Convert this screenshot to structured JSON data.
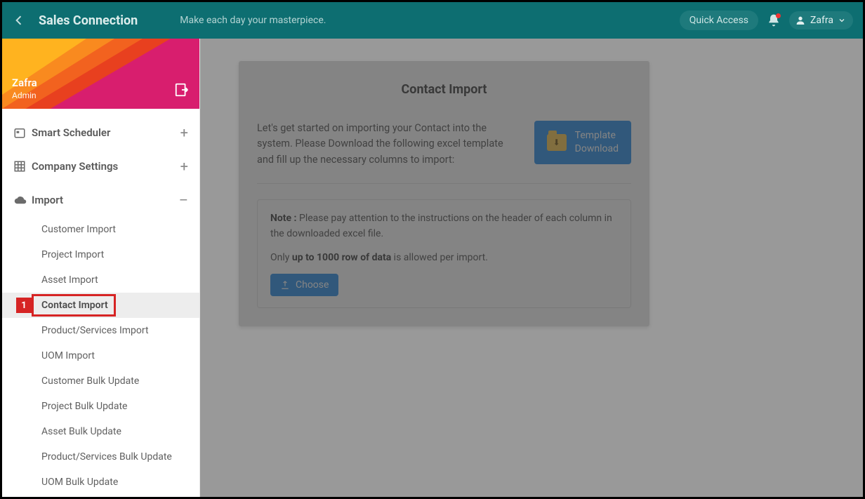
{
  "header": {
    "brand": "Sales Connection",
    "tagline": "Make each day your masterpiece.",
    "quick_access": "Quick Access",
    "user_name": "Zafra"
  },
  "profile": {
    "name": "Zafra",
    "role": "Admin"
  },
  "menu": {
    "smart_scheduler": "Smart Scheduler",
    "company_settings": "Company Settings",
    "import": "Import",
    "import_items": [
      "Customer Import",
      "Project Import",
      "Asset Import",
      "Contact Import",
      "Product/Services Import",
      "UOM Import",
      "Customer Bulk Update",
      "Project Bulk Update",
      "Asset Bulk Update",
      "Product/Services Bulk Update",
      "UOM Bulk Update"
    ],
    "active_index": 3
  },
  "callout": {
    "number": "1"
  },
  "main": {
    "title": "Contact Import",
    "intro": "Let's get started on importing your Contact into the system. Please Download the following excel template and fill up the necessary columns to import:",
    "template_btn_line1": "Template",
    "template_btn_line2": "Download",
    "note_label": "Note :",
    "note_text": " Please pay attention to the instructions on the header of each column in the downloaded excel file.",
    "limit_prefix": "Only ",
    "limit_bold": "up to 1000 row of data",
    "limit_suffix": " is allowed per import.",
    "choose": "Choose"
  }
}
